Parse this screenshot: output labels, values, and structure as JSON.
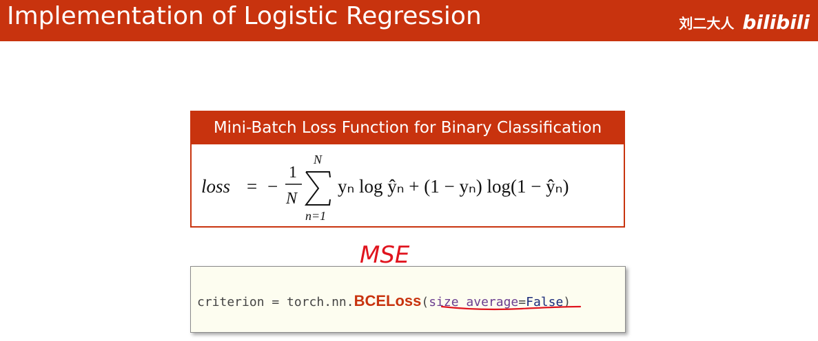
{
  "header": {
    "title": "Implementation of Logistic Regression",
    "brand_cn": "刘二大人",
    "brand_logo": "bilibili"
  },
  "loss_box": {
    "heading": "Mini-Batch Loss Function for Binary Classification",
    "formula": {
      "lhs": "loss",
      "eq": "=",
      "minus": "−",
      "frac_num": "1",
      "frac_den": "N",
      "sum_upper": "N",
      "sum_lower": "n=1",
      "body": "yₙ log ŷₙ + (1 − yₙ) log(1 − ŷₙ)"
    }
  },
  "annotation": {
    "text": "MSE"
  },
  "code": {
    "prefix": "criterion = torch.nn.",
    "class_name": "BCELoss",
    "open_paren": "(",
    "arg_name": "size_average",
    "arg_eq": "=",
    "arg_value": "False",
    "close_paren": ")"
  },
  "colors": {
    "accent": "#c8330e",
    "code_bg": "#fdfdf0",
    "annotation_red": "#e0141e"
  }
}
